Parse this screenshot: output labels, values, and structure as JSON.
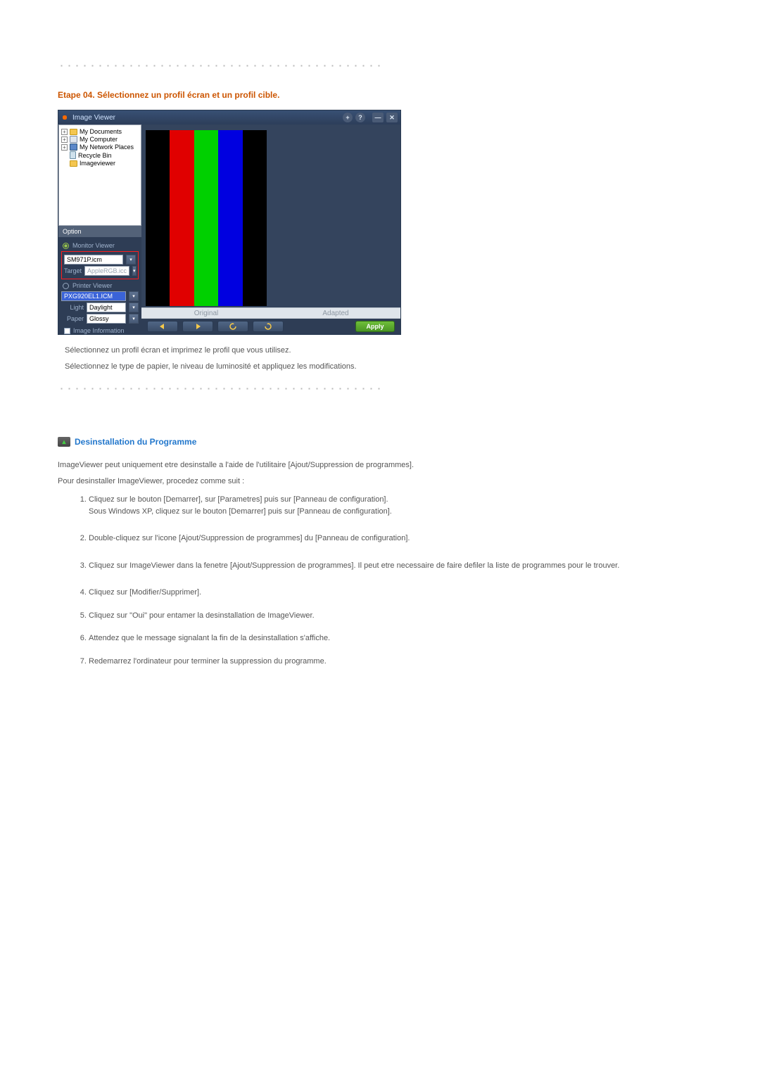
{
  "dividers": {
    "dots": "••••••••••••••••••••••••••••••••••••••••••"
  },
  "step4": {
    "heading": "Etape 04. Sélectionnez un profil écran et un profil cible.",
    "caption_original": "Original",
    "caption_adapted": "Adapted",
    "note1": "Sélectionnez un profil écran et imprimez le profil que vous utilisez.",
    "note2": "Sélectionnez le type de papier, le niveau de luminosité et appliquez les modifications."
  },
  "app": {
    "title": "Image Viewer",
    "titlebar_plus": "+",
    "titlebar_help": "?",
    "titlebar_min": "—",
    "titlebar_close": "✕",
    "tree": {
      "my_documents": "My Documents",
      "my_computer": "My Computer",
      "my_network": "My Network Places",
      "recycle_bin": "Recycle Bin",
      "imageviewer": "Imageviewer"
    },
    "option_label": "Option",
    "monitor_viewer": "Monitor Viewer",
    "printer_viewer": "Printer Viewer",
    "monitor_profile": "SM971P.icm",
    "target_label": "Target",
    "target_value": "AppleRGB.icc",
    "printer_profile": "PXG920EL1.ICM",
    "light_label": "Light",
    "light_value": "Daylight",
    "paper_label": "Paper",
    "paper_value": "Glossy",
    "image_info": "Image Information",
    "apply_label": "Apply"
  },
  "uninstall": {
    "heading": "Desinstallation du Programme",
    "intro1": "ImageViewer peut uniquement etre desinstalle a l'aide de l'utilitaire [Ajout/Suppression de programmes].",
    "intro2": "Pour desinstaller ImageViewer, procedez comme suit :",
    "steps": {
      "s1a": "Cliquez sur le bouton [Demarrer], sur [Parametres] puis sur [Panneau de configuration].",
      "s1b": "Sous Windows XP, cliquez sur le bouton [Demarrer] puis sur [Panneau de configuration].",
      "s2": "Double-cliquez sur l'icone [Ajout/Suppression de programmes] du [Panneau de configuration].",
      "s3": "Cliquez sur ImageViewer dans la fenetre [Ajout/Suppression de programmes]. Il peut etre necessaire de faire defiler la liste de programmes pour le trouver.",
      "s4": "Cliquez sur [Modifier/Supprimer].",
      "s5": "Cliquez sur \"Oui\" pour entamer la desinstallation de ImageViewer.",
      "s6": "Attendez que le message signalant la fin de la desinstallation s'affiche.",
      "s7": "Redemarrez l'ordinateur pour terminer la suppression du programme."
    }
  }
}
